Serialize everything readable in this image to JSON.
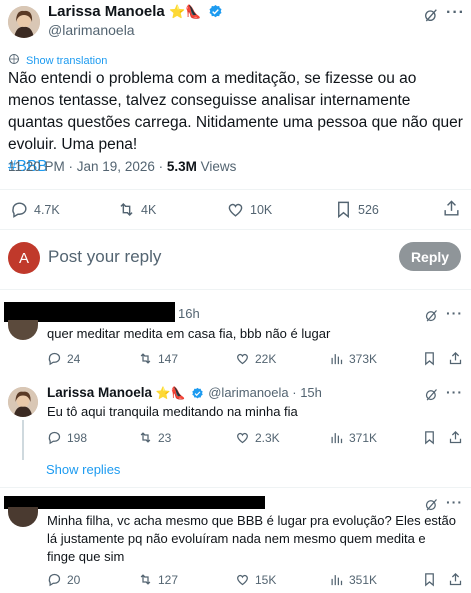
{
  "main_tweet": {
    "author_name": "Larissa Manoela",
    "author_handle": "@larimanoela",
    "badge_emoji": "⭐👠",
    "translation_link": "Show translation",
    "text": "Não entendi o problema com a meditação, se fizesse ou ao menos tentasse, talvez conseguisse analisar internamente quantas questões carrega. Nitidamente uma pessoa que não quer evoluir. Uma pena!",
    "hashtag": "#BBB",
    "time": "11:20 PM · Jan 19, 2026 · ",
    "views_count": "5.3M",
    "views_label": " Views",
    "stats": {
      "replies": "4.7K",
      "retweets": "4K",
      "likes": "10K",
      "bookmarks": "526"
    }
  },
  "composer": {
    "avatar_letter": "A",
    "avatar_color": "#c0392b",
    "placeholder": "Post your reply",
    "reply_button": "Reply"
  },
  "replies": [
    {
      "time": "16h",
      "text": "quer meditar medita em casa fia, bbb não é lugar",
      "stats": {
        "replies": "24",
        "retweets": "147",
        "likes": "22K",
        "views": "373K"
      }
    },
    {
      "author_name": "Larissa Manoela",
      "badge_emoji": "⭐👠",
      "author_handle": "@larimanoela",
      "time": " · 15h",
      "text": "Eu tô aqui tranquila meditando na minha fia",
      "stats": {
        "replies": "198",
        "retweets": "23",
        "likes": "2.3K",
        "views": "371K"
      },
      "show_replies": "Show replies"
    },
    {
      "text": "Minha filha, vc acha mesmo que BBB é lugar pra evolução? Eles estão lá justamente pq não evoluíram nada nem mesmo quem medita e finge que sim",
      "stats": {
        "replies": "20",
        "retweets": "127",
        "likes": "15K",
        "views": "351K"
      }
    }
  ],
  "colors": {
    "accent": "#1d9bf0",
    "muted": "#536471",
    "divider": "#eff3f4"
  }
}
